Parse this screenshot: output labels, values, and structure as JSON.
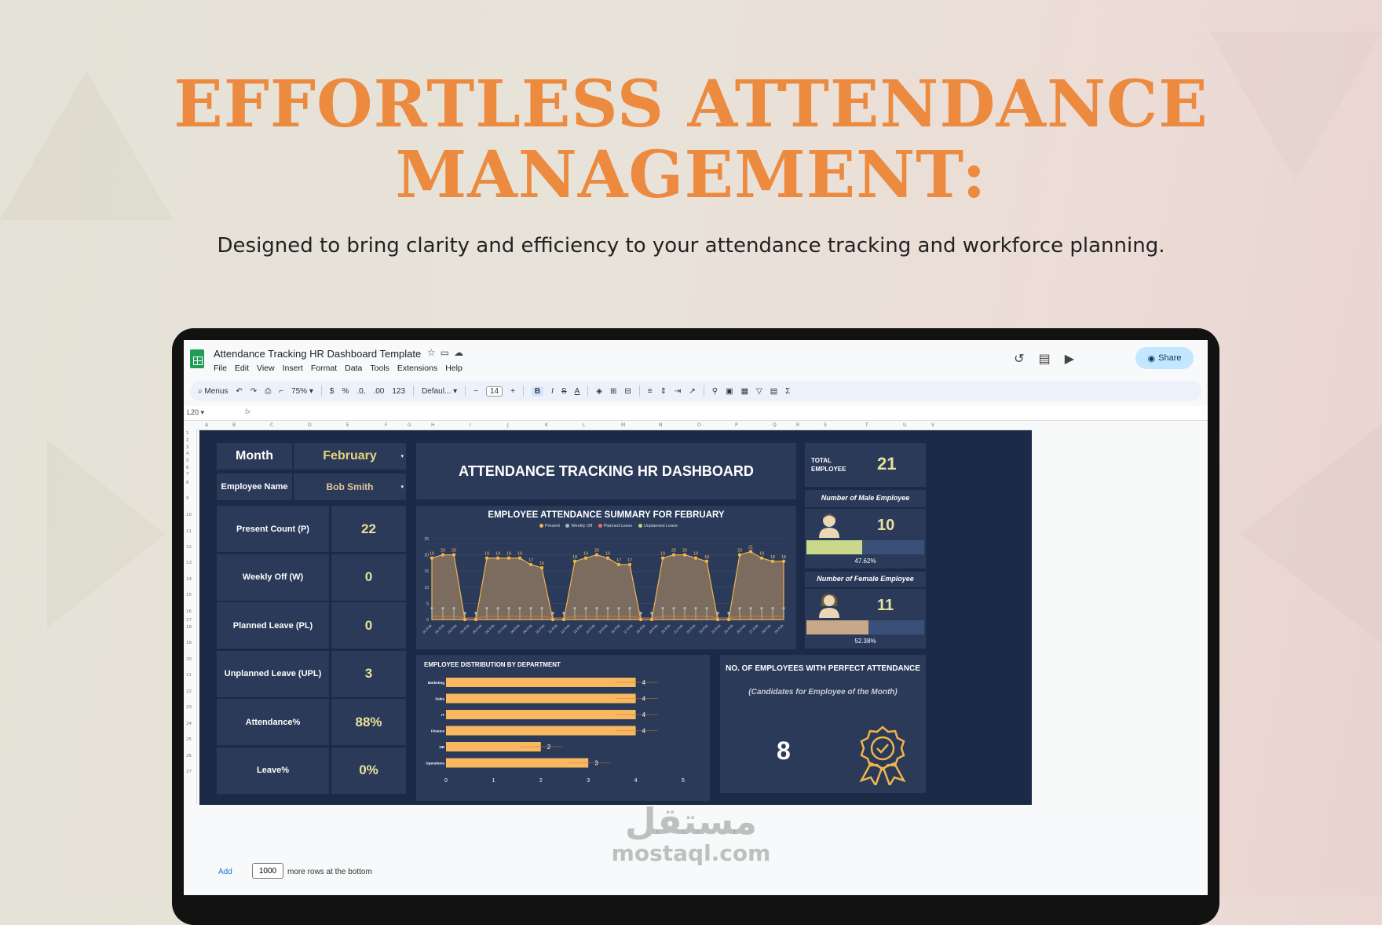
{
  "hero": {
    "headline_line1": "EFFORTLESS ATTENDANCE",
    "headline_line2": "MANAGEMENT:",
    "subheadline": "Designed to bring clarity and efficiency to your attendance tracking and workforce planning."
  },
  "app": {
    "doc_title": "Attendance Tracking HR Dashboard Template",
    "menu": [
      "File",
      "Edit",
      "View",
      "Insert",
      "Format",
      "Data",
      "Tools",
      "Extensions",
      "Help"
    ],
    "share_label": "Share",
    "toolbar": {
      "search": "Menus",
      "zoom": "75%",
      "currency": "$",
      "percent": "%",
      "dec_decrease": ".0,",
      "dec_increase": ".00",
      "number_format": "123",
      "font": "Defaul...",
      "minus": "−",
      "font_size": "14",
      "plus": "+",
      "bold": "B",
      "italic": "I",
      "strike": "S",
      "text_color": "A",
      "sum": "Σ"
    },
    "name_box": "L20",
    "fx_label": "fx",
    "columns": [
      "A",
      "B",
      "C",
      "D",
      "E",
      "F",
      "G",
      "H",
      "I",
      "J",
      "K",
      "L",
      "M",
      "N",
      "O",
      "P",
      "Q",
      "R",
      "S",
      "T",
      "U",
      "V"
    ],
    "rows": [
      "1",
      "2",
      "3",
      "4",
      "5",
      "6",
      "7",
      "8",
      "9",
      "10",
      "11",
      "12",
      "13",
      "14",
      "15",
      "16",
      "17",
      "18",
      "19",
      "20",
      "21",
      "22",
      "23",
      "24",
      "25",
      "26",
      "27"
    ],
    "footer": {
      "add_label": "Add",
      "rows_value": "1000",
      "rows_text": "more rows at the bottom"
    }
  },
  "dashboard": {
    "month_label": "Month",
    "month_value": "February",
    "employee_label": "Employee Name",
    "employee_value": "Bob Smith",
    "metrics": [
      {
        "label": "Present Count (P)",
        "value": "22"
      },
      {
        "label": "Weekly Off (W)",
        "value": "0"
      },
      {
        "label": "Planned Leave (PL)",
        "value": "0"
      },
      {
        "label": "Unplanned Leave (UPL)",
        "value": "3"
      },
      {
        "label": "Attendance%",
        "value": "88%"
      },
      {
        "label": "Leave%",
        "value": "0%"
      }
    ],
    "title": "ATTENDANCE TRACKING HR DASHBOARD",
    "total_employee_label": "TOTAL EMPLOYEE",
    "total_employee_value": "21",
    "male": {
      "label": "Number of Male Employee",
      "value": "10",
      "pct_text": "47.62%",
      "pct": 0.4762
    },
    "female": {
      "label": "Number of Female Employee",
      "value": "11",
      "pct_text": "52.38%",
      "pct": 0.5238
    },
    "perfect": {
      "title": "NO. OF EMPLOYEES WITH PERFECT ATTENDANCE",
      "subtitle": "(Candidates for Employee of the Month)",
      "value": "8"
    },
    "colors": {
      "bg": "#1b2a46",
      "panel": "#2a3a58",
      "accent": "#e8e29a",
      "bar": "#f7b860",
      "male_bar": "#c9d88a",
      "female_bar": "#c7a98a"
    }
  },
  "watermark": {
    "arabic": "مستقل",
    "latin": "mostaql.com"
  },
  "chart_data": [
    {
      "type": "area",
      "title": "EMPLOYEE ATTENDANCE SUMMARY FOR  FEBRUARY",
      "legend": [
        "Present",
        "Weekly Off",
        "Planned Leave",
        "Unplanned Leave"
      ],
      "series_colors": [
        "#f0b44c",
        "#a9b5c4",
        "#e3735b",
        "#b7d67a"
      ],
      "x": [
        "01-Feb",
        "02-Feb",
        "03-Feb",
        "04-Feb",
        "05-Feb",
        "06-Feb",
        "07-Feb",
        "08-Feb",
        "09-Feb",
        "10-Feb",
        "11-Feb",
        "12-Feb",
        "13-Feb",
        "14-Feb",
        "15-Feb",
        "16-Feb",
        "17-Feb",
        "18-Feb",
        "19-Feb",
        "20-Feb",
        "21-Feb",
        "22-Feb",
        "23-Feb",
        "24-Feb",
        "25-Feb",
        "26-Feb",
        "27-Feb",
        "28-Feb",
        "29-Feb"
      ],
      "series": [
        {
          "name": "Present",
          "values": [
            19,
            20,
            20,
            0,
            0,
            19,
            19,
            19,
            19,
            17,
            16,
            0,
            0,
            18,
            19,
            20,
            19,
            17,
            17,
            0,
            0,
            19,
            20,
            20,
            19,
            18,
            0,
            0,
            20,
            21,
            19,
            18,
            18
          ]
        }
      ],
      "present": [
        19,
        20,
        20,
        0,
        0,
        19,
        19,
        19,
        19,
        17,
        16,
        0,
        0,
        18,
        19,
        20,
        19,
        17,
        17,
        0,
        0,
        19,
        20,
        20,
        19,
        18,
        0,
        0,
        20,
        21,
        19,
        18,
        18
      ],
      "present_labels": [
        "19",
        "20",
        "20",
        "",
        "",
        "19",
        "19",
        "19",
        "19",
        "17",
        "16",
        "",
        "",
        "18",
        "19",
        "20",
        "19",
        "17",
        "17",
        "",
        "",
        "19",
        "20",
        "20",
        "19",
        "18",
        "",
        "",
        "20",
        "21",
        "19",
        "18",
        "18"
      ],
      "y_ticks": [
        "0",
        "5",
        "10",
        "15",
        "20",
        "25"
      ],
      "ylim": [
        0,
        25
      ]
    },
    {
      "type": "bar",
      "title": "EMPLOYEE DISTRIBUTION BY DEPARTMENT",
      "categories": [
        "Marketing",
        "Sales",
        "IT",
        "Finance",
        "HR",
        "Operations"
      ],
      "values": [
        4,
        4,
        4,
        4,
        2,
        3
      ],
      "value_labels": [
        "4",
        "4",
        "4",
        "4",
        "2",
        "3"
      ],
      "x_ticks": [
        "0",
        "1",
        "2",
        "3",
        "4",
        "5"
      ],
      "xlim": [
        0,
        5
      ]
    }
  ]
}
